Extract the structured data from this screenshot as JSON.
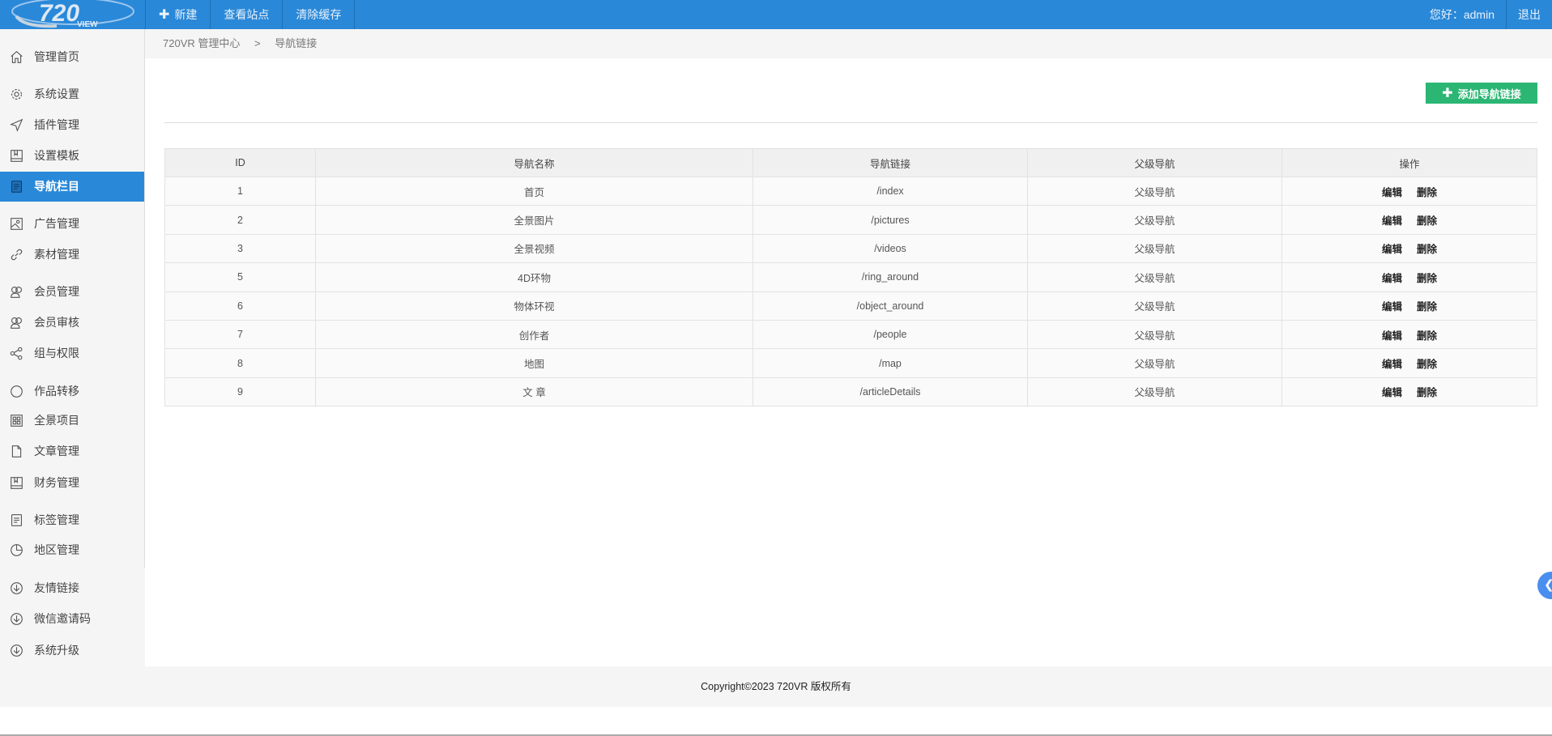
{
  "header": {
    "logo_text": "720",
    "logo_sub": "VIEW",
    "nav": [
      "新建",
      "查看站点",
      "清除缓存"
    ],
    "greeting": "您好：admin",
    "logout": "退出"
  },
  "breadcrumb": [
    "720VR 管理中心",
    ">",
    "导航链接"
  ],
  "sidebar": {
    "items": [
      {
        "label": "管理首页",
        "icon": "home"
      },
      {
        "label": "系统设置",
        "icon": "gear"
      },
      {
        "label": "插件管理",
        "icon": "send"
      },
      {
        "label": "设置模板",
        "icon": "book"
      },
      {
        "label": "导航栏目",
        "icon": "doc",
        "active": true
      },
      {
        "label": "广告管理",
        "icon": "image"
      },
      {
        "label": "素材管理",
        "icon": "link"
      },
      {
        "label": "会员管理",
        "icon": "users"
      },
      {
        "label": "会员审核",
        "icon": "users"
      },
      {
        "label": "组与权限",
        "icon": "share"
      },
      {
        "label": "作品转移",
        "icon": "circle"
      },
      {
        "label": "全景项目",
        "icon": "grid"
      },
      {
        "label": "文章管理",
        "icon": "file"
      },
      {
        "label": "财务管理",
        "icon": "book"
      },
      {
        "label": "标签管理",
        "icon": "doc"
      },
      {
        "label": "地区管理",
        "icon": "pie"
      },
      {
        "label": "友情链接",
        "icon": "download"
      },
      {
        "label": "微信邀请码",
        "icon": "download"
      },
      {
        "label": "系统升级",
        "icon": "download"
      }
    ]
  },
  "add_button": "添加导航链接",
  "table": {
    "headers": [
      "ID",
      "导航名称",
      "导航链接",
      "父级导航",
      "操作"
    ],
    "rows": [
      [
        "1",
        "首页",
        "/index",
        "父级导航"
      ],
      [
        "2",
        "全景图片",
        "/pictures",
        "父级导航"
      ],
      [
        "3",
        "全景视频",
        "/videos",
        "父级导航"
      ],
      [
        "5",
        "4D环物",
        "/ring_around",
        "父级导航"
      ],
      [
        "6",
        "物体环视",
        "/object_around",
        "父级导航"
      ],
      [
        "7",
        "创作者",
        "/people",
        "父级导航"
      ],
      [
        "8",
        "地图",
        "/map",
        "父级导航"
      ],
      [
        "9",
        "文 章",
        "/articleDetails",
        "父级导航"
      ]
    ],
    "edit": "编辑",
    "delete": "删除"
  },
  "footer": "Copyright©2023 720VR 版权所有",
  "colors": {
    "primary": "#2a88d8",
    "success": "#2bb673"
  }
}
